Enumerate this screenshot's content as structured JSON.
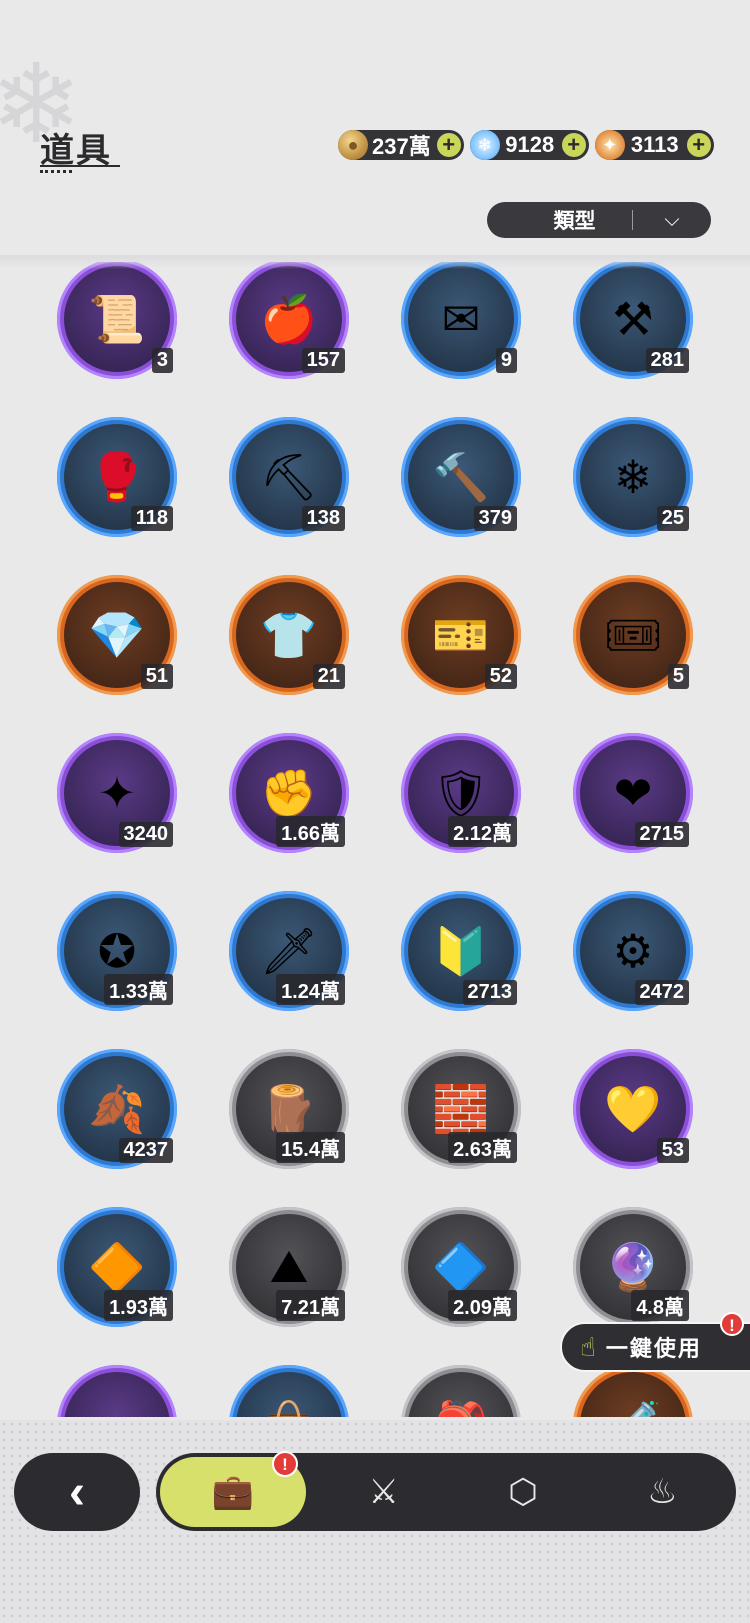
{
  "header": {
    "title": "道具"
  },
  "currencies": [
    {
      "icon": "gold-coin-icon",
      "value": "237萬"
    },
    {
      "icon": "crystal-gem-icon",
      "value": "9128"
    },
    {
      "icon": "star-shard-icon",
      "value": "3113"
    }
  ],
  "filter": {
    "label": "類型",
    "icon": "chevron-down-icon"
  },
  "items": [
    {
      "icon": "scroll-icon",
      "glyph": "📜",
      "rarity": "purple",
      "count": "3"
    },
    {
      "icon": "apple-icon",
      "glyph": "🍎",
      "rarity": "purple",
      "count": "157"
    },
    {
      "icon": "letter-icon",
      "glyph": "✉",
      "rarity": "blue",
      "count": "9"
    },
    {
      "icon": "shovel-icon",
      "glyph": "⚒",
      "rarity": "blue",
      "count": "281"
    },
    {
      "icon": "glove-icon",
      "glyph": "🥊",
      "rarity": "blue",
      "count": "118"
    },
    {
      "icon": "pickaxe-icon",
      "glyph": "⛏",
      "rarity": "blue",
      "count": "138"
    },
    {
      "icon": "hammer-icon",
      "glyph": "🔨",
      "rarity": "blue",
      "count": "379"
    },
    {
      "icon": "star-orb-icon",
      "glyph": "❄",
      "rarity": "blue",
      "count": "25"
    },
    {
      "icon": "gem-heart-icon",
      "glyph": "💎",
      "rarity": "orange",
      "count": "51"
    },
    {
      "icon": "shirt-token-icon",
      "glyph": "👕",
      "rarity": "orange",
      "count": "21"
    },
    {
      "icon": "ticket-card-icon",
      "glyph": "🎫",
      "rarity": "orange",
      "count": "52"
    },
    {
      "icon": "rainbow-ticket-icon",
      "glyph": "🎟",
      "rarity": "orange",
      "count": "5"
    },
    {
      "icon": "star-coin-icon",
      "glyph": "✦",
      "rarity": "purple",
      "count": "3240"
    },
    {
      "icon": "fist-coin-icon",
      "glyph": "✊",
      "rarity": "purple",
      "count": "1.66萬"
    },
    {
      "icon": "crest-coin-icon",
      "glyph": "🛡",
      "rarity": "purple",
      "count": "2.12萬"
    },
    {
      "icon": "heart-coin-icon",
      "glyph": "❤",
      "rarity": "purple",
      "count": "2715"
    },
    {
      "icon": "silver-coin-icon",
      "glyph": "✪",
      "rarity": "blue",
      "count": "1.33萬"
    },
    {
      "icon": "dagger-icon",
      "glyph": "🗡",
      "rarity": "blue",
      "count": "1.24萬"
    },
    {
      "icon": "scale-shield-icon",
      "glyph": "🔰",
      "rarity": "blue",
      "count": "2713"
    },
    {
      "icon": "gear-icon",
      "glyph": "⚙",
      "rarity": "blue",
      "count": "2472"
    },
    {
      "icon": "leaf-icon",
      "glyph": "🍂",
      "rarity": "blue",
      "count": "4237"
    },
    {
      "icon": "logs-icon",
      "glyph": "🪵",
      "rarity": "gray",
      "count": "15.4萬"
    },
    {
      "icon": "stone-bricks-icon",
      "glyph": "🧱",
      "rarity": "gray",
      "count": "2.63萬"
    },
    {
      "icon": "gold-crystal-icon",
      "glyph": "💛",
      "rarity": "purple",
      "count": "53"
    },
    {
      "icon": "red-crystal-icon",
      "glyph": "🔶",
      "rarity": "blue",
      "count": "1.93萬"
    },
    {
      "icon": "sand-pile-icon",
      "glyph": "⛰",
      "rarity": "gray",
      "count": "7.21萬"
    },
    {
      "icon": "blue-crystal-icon",
      "glyph": "🔷",
      "rarity": "gray",
      "count": "2.09萬"
    },
    {
      "icon": "purple-orb-icon",
      "glyph": "🔮",
      "rarity": "gray",
      "count": "4.8萬"
    },
    {
      "icon": "seed-bag-icon",
      "glyph": "👝",
      "rarity": "purple",
      "count": ""
    },
    {
      "icon": "blue-bag-icon",
      "glyph": "👜",
      "rarity": "blue",
      "count": ""
    },
    {
      "icon": "brown-bag-icon",
      "glyph": "🎒",
      "rarity": "gray",
      "count": ""
    },
    {
      "icon": "potion-bottle-icon",
      "glyph": "🧪",
      "rarity": "orange",
      "count": ""
    }
  ],
  "use_all": {
    "label": "一鍵使用",
    "icon": "hand-pointer-icon",
    "alert": "!"
  },
  "bottom_nav": {
    "back_icon": "back-chevron-icon",
    "tabs": [
      {
        "name": "tab-bag",
        "icon": "briefcase-icon",
        "glyph": "💼",
        "active": true,
        "alert": "!"
      },
      {
        "name": "tab-character",
        "icon": "knight-helmet-icon",
        "glyph": "⚔",
        "active": false,
        "alert": ""
      },
      {
        "name": "tab-gem",
        "icon": "hexagon-gem-icon",
        "glyph": "⬡",
        "active": false,
        "alert": ""
      },
      {
        "name": "tab-cooking",
        "icon": "cooking-pot-icon",
        "glyph": "♨",
        "active": false,
        "alert": ""
      }
    ]
  }
}
